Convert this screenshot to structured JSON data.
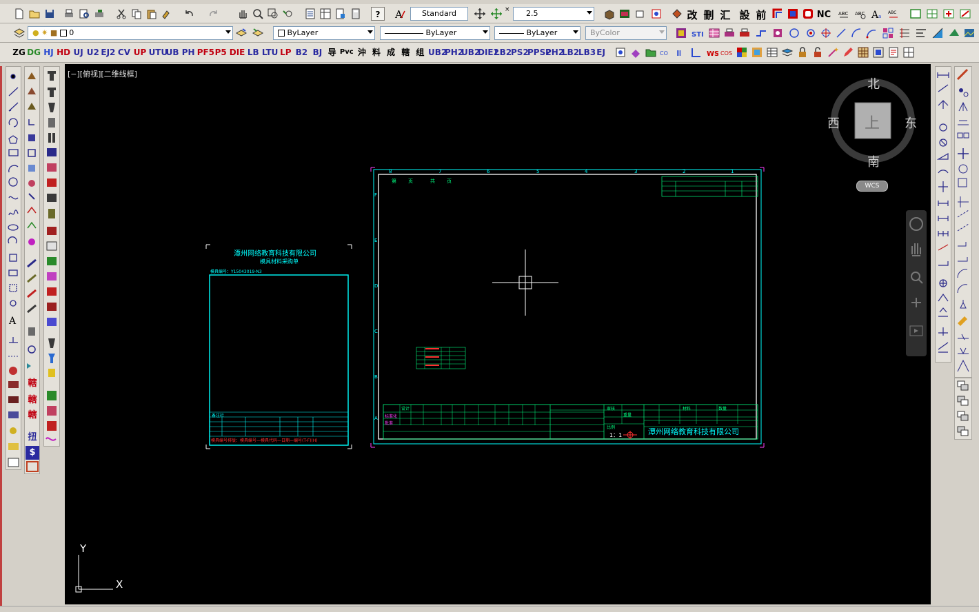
{
  "toolbar_row1": {
    "text_style_value": "Standard",
    "dim_scale_value": "2.5",
    "cad_glyphs": [
      "改",
      "刪",
      "汇",
      "設",
      "前",
      "NC"
    ]
  },
  "toolbar_row2": {
    "layer_value": "0",
    "color_value": "ByLayer",
    "linetype_value": "ByLayer",
    "lineweight_value": "ByLayer",
    "plotstyle_value": "ByColor"
  },
  "toolbar_row3": {
    "tools": [
      "ZG",
      "DG",
      "HJ",
      "HD",
      "UJ",
      "U2",
      "EJ2",
      "CV",
      "UP",
      "UTU",
      "UB",
      "PH",
      "PF5",
      "P5",
      "DIE",
      "LB",
      "LTU",
      "LP",
      "B2",
      "BJ",
      "导",
      "Pvc",
      "沖",
      "料",
      "成",
      "轄",
      "组",
      "UB2",
      "PH2",
      "UB2",
      "DIE2",
      "LB2",
      "PS2",
      "PPS2",
      "PH2",
      "LB2",
      "LB3",
      "EJ"
    ]
  },
  "left_tool_glyphs": [
    "轄",
    "轄",
    "轄",
    "扭",
    "$"
  ],
  "canvas": {
    "viewport_label": "[−][俯视][二维线框]",
    "viewcube": {
      "north": "北",
      "south": "南",
      "east": "东",
      "west": "西",
      "top": "上",
      "ucs": "WCS"
    },
    "ucs_x": "X",
    "ucs_y": "Y"
  },
  "drawing": {
    "small_sheet": {
      "company": "潭州网络教育科技有限公司",
      "subtitle": "模具材料采购单",
      "order_no": "模具编号：Y15043019-N3",
      "note": "备注栏",
      "footer": "模具编号排版：模具编号—模具代码—日期—编号(T-F)(H)"
    },
    "main_sheet": {
      "col_labels": [
        "8",
        "7",
        "6",
        "5",
        "4",
        "3",
        "2",
        "1"
      ],
      "row_labels": [
        "F",
        "E",
        "D",
        "C",
        "B",
        "A"
      ],
      "top_notes": [
        "第",
        "页",
        "共",
        "页"
      ],
      "company": "潭州网络教育科技有限公司",
      "scale": "1：1",
      "title_cells": [
        "设计",
        "审核",
        "标准化",
        "批准",
        "比例",
        "重量",
        "材料",
        "数量"
      ]
    }
  }
}
